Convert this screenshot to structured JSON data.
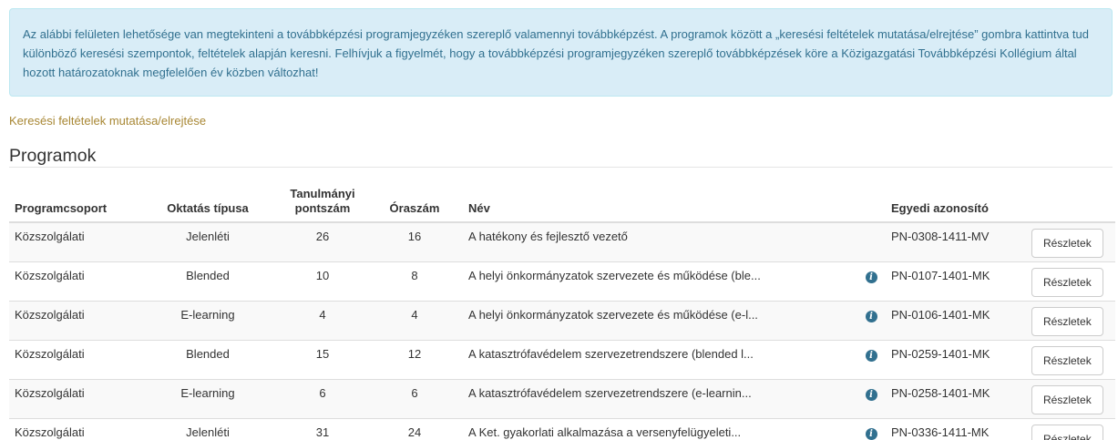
{
  "alert": {
    "text": "Az alábbi felületen lehetősége van megtekinteni a továbbképzési programjegyzéken szereplő valamennyi továbbképzést. A programok között a „keresési feltételek mutatása/elrejtése” gombra kattintva tud különböző keresési szempontok, feltételek alapján keresni. Felhívjuk a figyelmét, hogy a továbbképzési programjegyzéken szereplő továbbképzések köre a Közigazgatási Továbbképzési Kollégium által hozott határozatoknak megfelelően év közben változhat!"
  },
  "search_toggle_label": "Keresési feltételek mutatása/elrejtése",
  "section_title": "Programok",
  "table": {
    "headers": {
      "group": "Programcsoport",
      "type": "Oktatás típusa",
      "points_line1": "Tanulmányi",
      "points_line2": "pontszám",
      "hours": "Óraszám",
      "name": "Név",
      "id": "Egyedi azonosító"
    },
    "details_label": "Részletek",
    "rows": [
      {
        "group": "Közszolgálati",
        "type": "Jelenléti",
        "points": "26",
        "hours": "16",
        "name": "A hatékony és fejlesztő vezető",
        "info": false,
        "id": "PN-0308-1411-MV"
      },
      {
        "group": "Közszolgálati",
        "type": "Blended",
        "points": "10",
        "hours": "8",
        "name": "A helyi önkormányzatok szervezete és működése (ble...",
        "info": true,
        "id": "PN-0107-1401-MK"
      },
      {
        "group": "Közszolgálati",
        "type": "E-learning",
        "points": "4",
        "hours": "4",
        "name": "A helyi önkormányzatok szervezete és működése (e-l...",
        "info": true,
        "id": "PN-0106-1401-MK"
      },
      {
        "group": "Közszolgálati",
        "type": "Blended",
        "points": "15",
        "hours": "12",
        "name": "A katasztrófavédelem szervezetrendszere (blended l...",
        "info": true,
        "id": "PN-0259-1401-MK"
      },
      {
        "group": "Közszolgálati",
        "type": "E-learning",
        "points": "6",
        "hours": "6",
        "name": "A katasztrófavédelem szervezetrendszere (e-learnin...",
        "info": true,
        "id": "PN-0258-1401-MK"
      },
      {
        "group": "Közszolgálati",
        "type": "Jelenléti",
        "points": "31",
        "hours": "24",
        "name": "A Ket. gyakorlati alkalmazása a versenyfelügyeleti...",
        "info": true,
        "id": "PN-0336-1411-MK"
      }
    ]
  },
  "icons": {
    "info": "info-icon",
    "info_glyph": "i"
  },
  "colors": {
    "alert_bg": "#d9edf7",
    "alert_text": "#31708f",
    "link": "#a88734"
  }
}
